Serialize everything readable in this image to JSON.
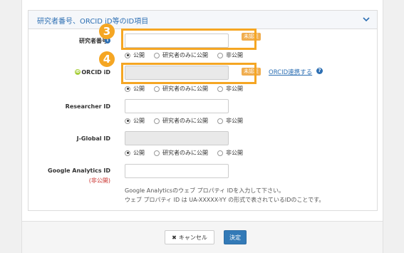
{
  "section": {
    "title": "研究者番号、ORCID iD等のID項目"
  },
  "fields": {
    "researcher_number": {
      "label": "研究者番号",
      "badge": "未認証"
    },
    "orcid": {
      "label": "ORCID iD",
      "badge": "未認証",
      "link": "ORCID連携する",
      "icon_text": "iD"
    },
    "researcher_id": {
      "label": "Researcher ID"
    },
    "jglobal_id": {
      "label": "J-Global ID"
    },
    "google_analytics": {
      "label": "Google Analytics ID",
      "note": "(非公開)",
      "help_line1": "Google Analyticsのウェブ プロパティ IDを入力して下さい。",
      "help_line2": "ウェブ プロパティ ID は UA-XXXXX-YY の形式で表されているIDのことです。"
    }
  },
  "visibility_options": [
    "公開",
    "研究者のみに公開",
    "非公開"
  ],
  "annotations": {
    "step3": "3",
    "step4": "4"
  },
  "footer": {
    "cancel_label": "キャンセル",
    "cancel_icon": "✖",
    "save_label": "決定"
  },
  "colors": {
    "accent": "#2d6fb3",
    "badge": "#f0ad4e",
    "highlight": "#f5a623",
    "save_button": "#337ab7",
    "orcid_green": "#a6ce39",
    "private_red": "#c9302c"
  }
}
